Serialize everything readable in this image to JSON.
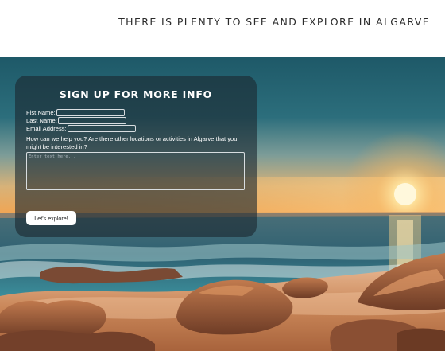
{
  "header": {
    "title": "THERE IS PLENTY TO SEE AND EXPLORE IN ALGARVE"
  },
  "form": {
    "title": "SIGN UP FOR MORE INFO",
    "first_name_label": "Fist Name:",
    "last_name_label": "Last Name:",
    "email_label": "Email Address:",
    "question": "How can we help you? Are there other locations or activities in Algarve that you might be interested in?",
    "textarea_placeholder": "Enter text here...",
    "submit_label": "Let's explore!"
  },
  "colors": {
    "panel": "#1c2830",
    "sun": "#fff3c4",
    "sky_top": "#1e5968",
    "sky_horizon": "#f2a552",
    "sand": "#c98658",
    "rock": "#8a4f33"
  }
}
